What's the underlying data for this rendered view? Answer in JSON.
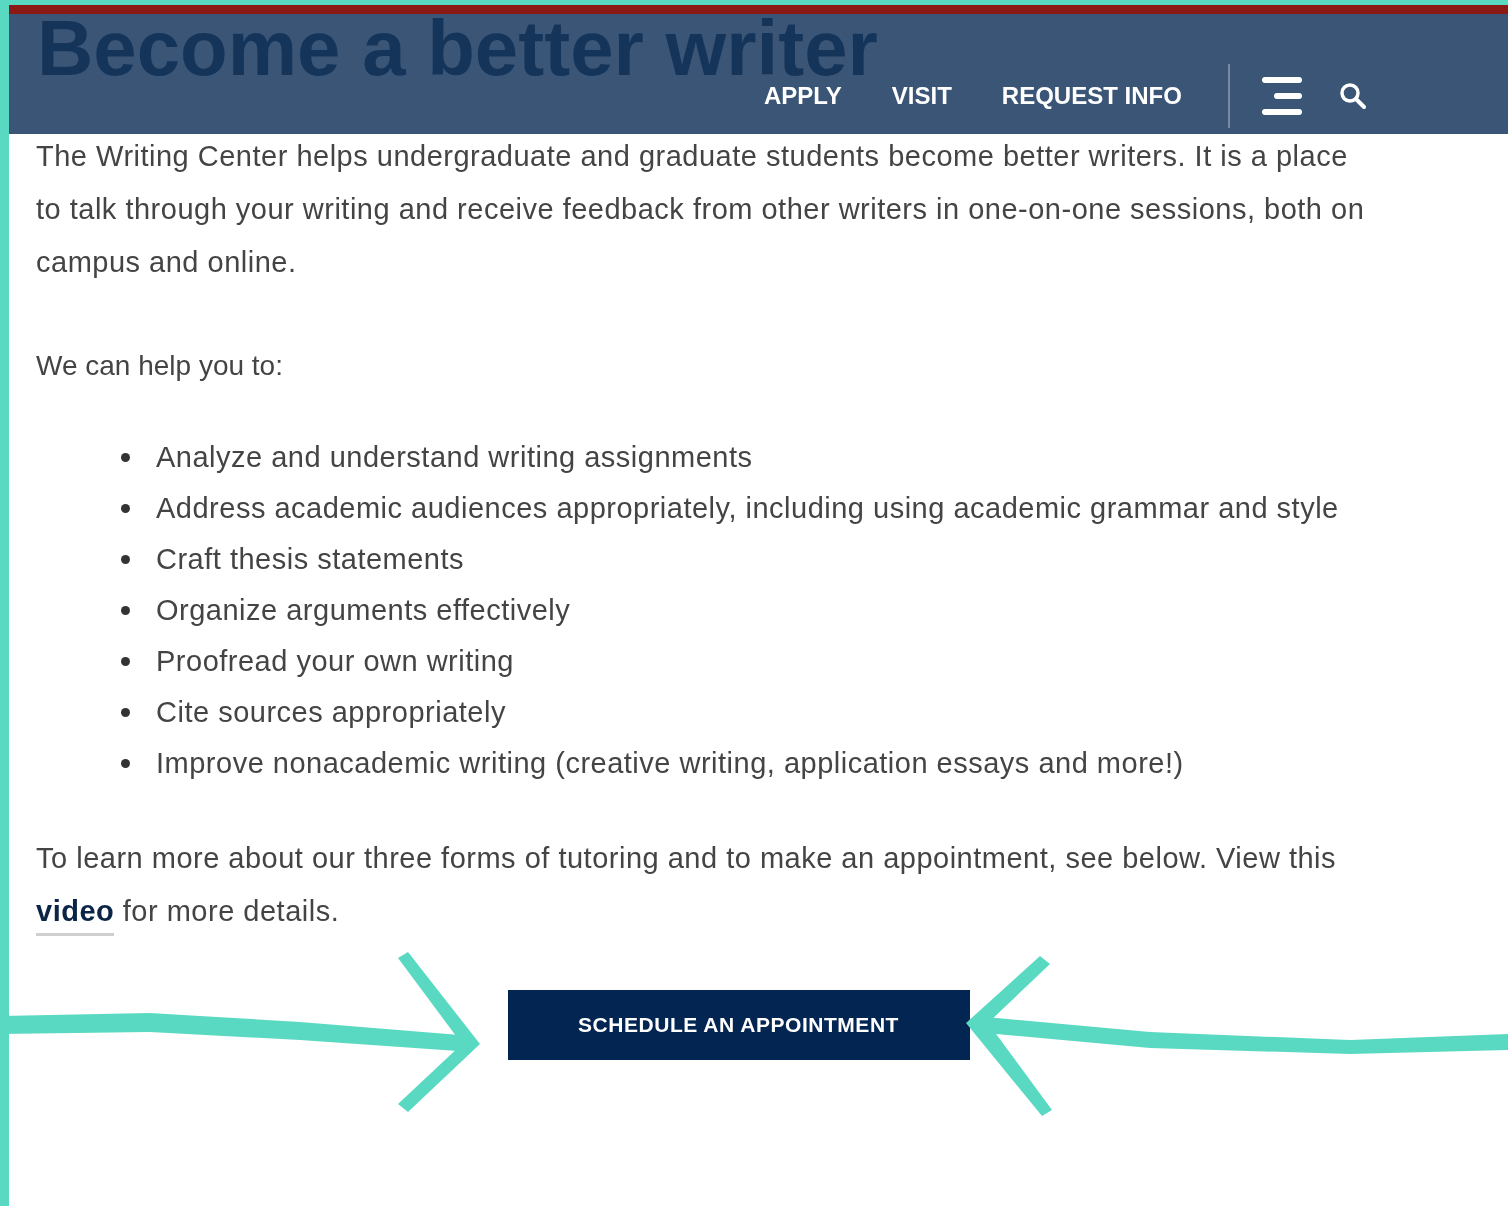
{
  "header": {
    "nav": [
      {
        "label": "APPLY"
      },
      {
        "label": "VISIT"
      },
      {
        "label": "REQUEST INFO"
      }
    ]
  },
  "title": "Become a better writer",
  "intro": "The Writing Center helps undergraduate and graduate students become better writers. It is a place to talk through your writing and receive feedback from other writers in one-on-one sessions, both on campus and online.",
  "help_heading": "We can help you to:",
  "bullets": [
    "Analyze and understand writing assignments",
    "Address academic audiences appropriately, including using academic grammar and style",
    "Craft thesis statements",
    "Organize arguments effectively",
    "Proofread your own writing",
    "Cite sources appropriately",
    "Improve nonacademic writing (creative writing, application essays and more!)"
  ],
  "more": {
    "before": "To learn more about our three forms of tutoring and to make an appointment, see below. View this ",
    "link": "video",
    "after": " for more details."
  },
  "cta": "SCHEDULE AN APPOINTMENT"
}
